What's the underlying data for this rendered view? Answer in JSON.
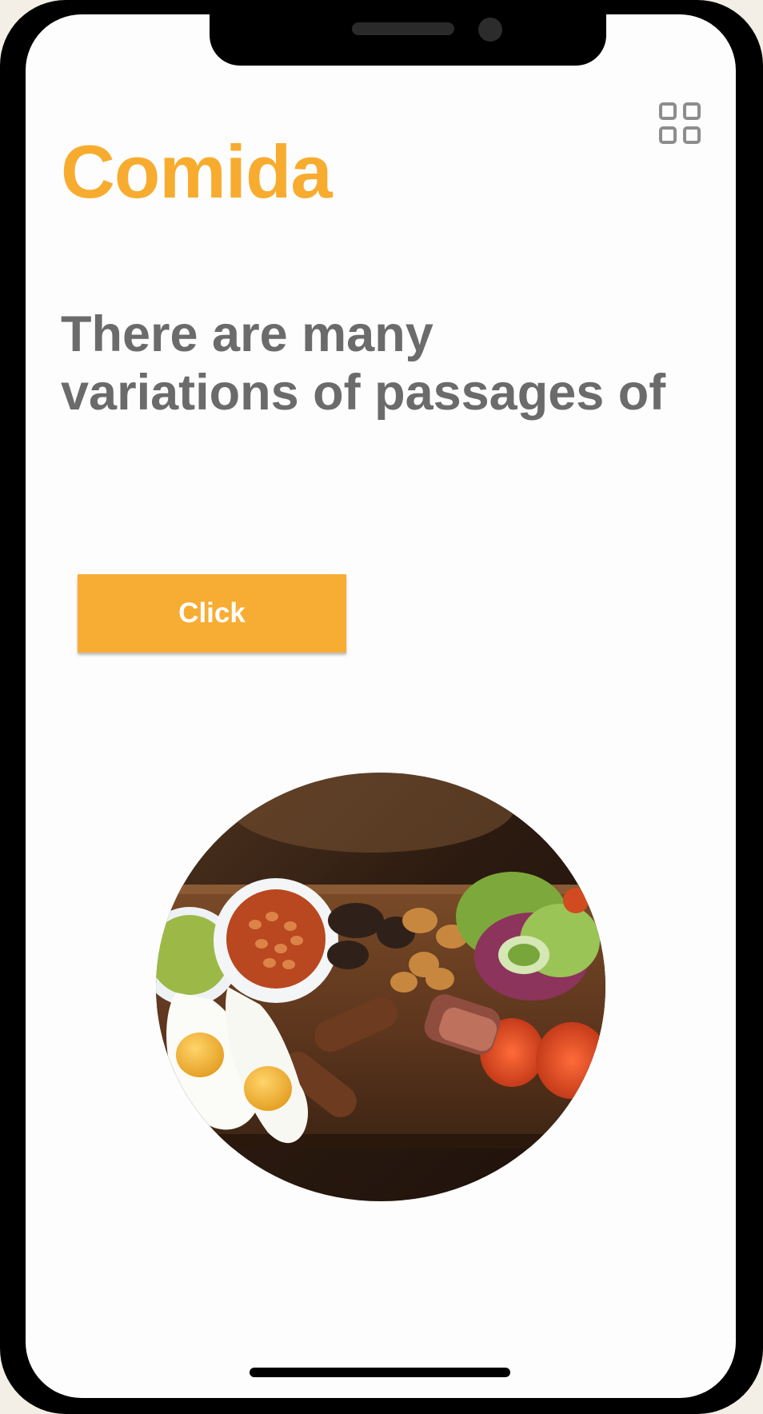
{
  "app": {
    "title": "Comida"
  },
  "header": {
    "menu_icon": "grid-menu-icon"
  },
  "content": {
    "headline": "There are many variations of passages of",
    "button_label": "Click",
    "image_subject": "breakfast platter"
  },
  "colors": {
    "accent": "#f7ac30",
    "heading_gray": "#6b6b6b",
    "background": "#fcfdfc"
  }
}
